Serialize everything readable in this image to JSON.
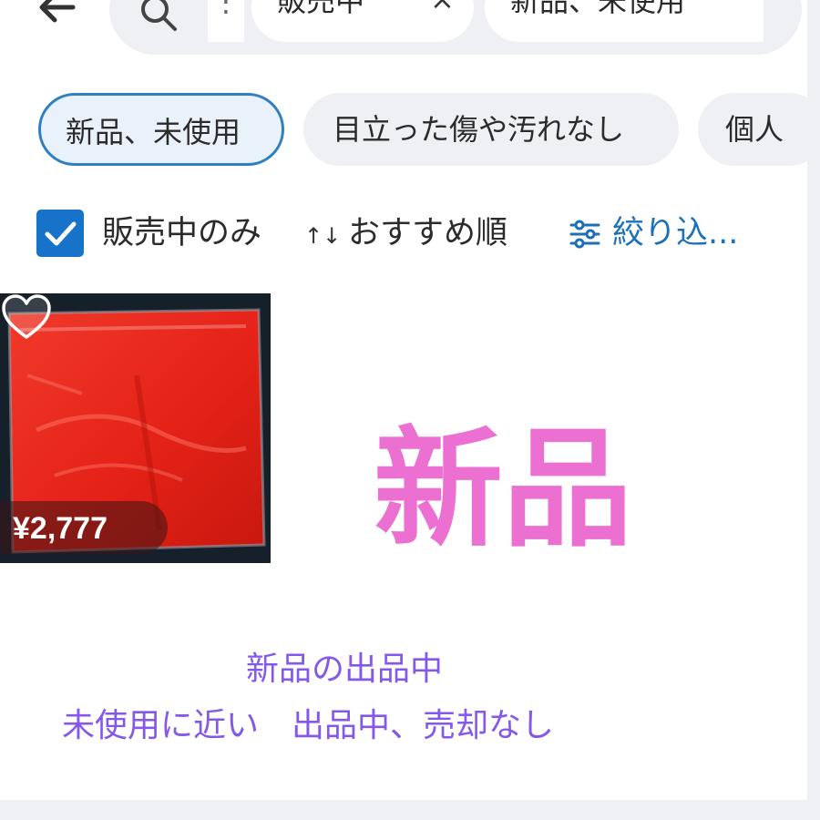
{
  "header": {
    "back_icon": "arrow-left-icon",
    "search_icon": "search-icon",
    "search_overflow": "⋮",
    "chips": [
      {
        "label": "販売中",
        "close": "×"
      },
      {
        "label": "新品、未使用"
      }
    ]
  },
  "filters": {
    "chips": [
      {
        "label": "新品、未使用",
        "selected": true
      },
      {
        "label": "目立った傷や汚れなし",
        "selected": false
      },
      {
        "label": "個人",
        "selected": false
      }
    ]
  },
  "options": {
    "on_sale_only": {
      "label": "販売中のみ",
      "checked": true
    },
    "sort_icon": "↑↓",
    "sort_label": "おすすめ順",
    "filter_icon": "sliders-icon",
    "filter_link": "絞り込..."
  },
  "product": {
    "price": "¥2,777",
    "liked": false,
    "heart_icon": "heart-icon"
  },
  "overlay": {
    "headline": "新品",
    "line1": "新品の出品中",
    "line2": "未使用に近い　出品中、売却なし"
  },
  "colors": {
    "accent_blue": "#1673c9",
    "headline_pink": "#ec6fd2",
    "note_purple": "#8458ea",
    "product_red": "#e8281c"
  }
}
